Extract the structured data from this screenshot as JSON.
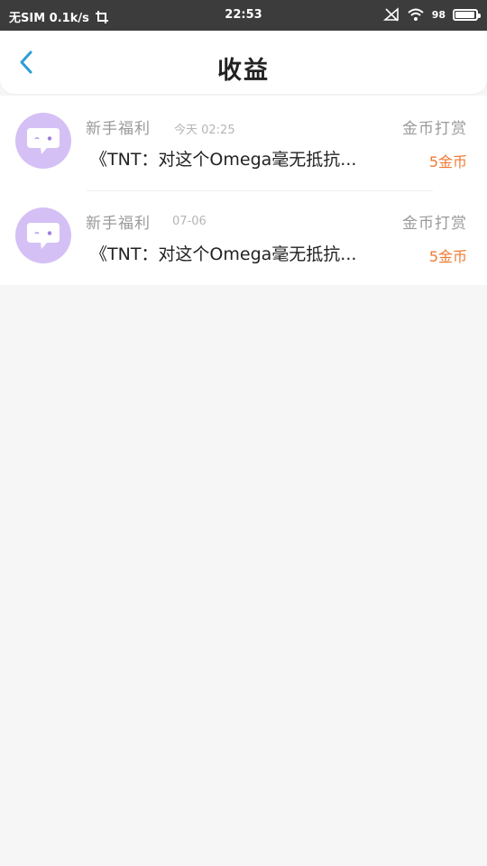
{
  "status_bar": {
    "carrier": "无SIM 0.1k/s",
    "time": "22:53",
    "battery": "98"
  },
  "header": {
    "title": "收益",
    "back_icon": "chevron-left-icon",
    "accent": "#2a9fd6"
  },
  "items": [
    {
      "title": "新手福利",
      "time": "今天 02:25",
      "tag": "金币打赏",
      "desc": "《TNT：对这个Omega毫无抵抗...",
      "amount": "5金币"
    },
    {
      "title": "新手福利",
      "time": "07-06",
      "tag": "金币打赏",
      "desc": "《TNT：对这个Omega毫无抵抗...",
      "amount": "5金币"
    }
  ],
  "colors": {
    "avatar_bg": "#d4c0f5",
    "amount": "#f07a32"
  }
}
